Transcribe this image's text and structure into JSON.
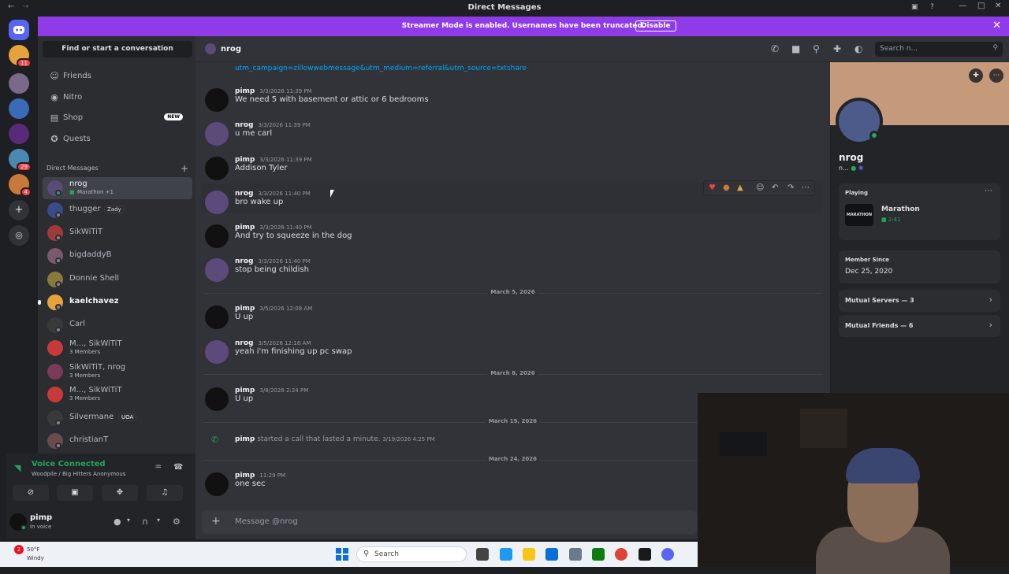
{
  "titlebar": {
    "title": "Direct Messages"
  },
  "banner": {
    "text": "Streamer Mode is enabled. Usernames have been truncated.",
    "button": "Disable"
  },
  "servers": [
    {
      "badge": ""
    },
    {
      "badge": "11"
    },
    {
      "badge": ""
    },
    {
      "badge": ""
    },
    {
      "badge": ""
    },
    {
      "badge": "29"
    },
    {
      "badge": "4"
    }
  ],
  "sidebar": {
    "find": "Find or start a conversation",
    "nav": [
      {
        "label": "Friends",
        "icon": "friends-icon"
      },
      {
        "label": "Nitro",
        "icon": "nitro-icon"
      },
      {
        "label": "Shop",
        "icon": "shop-icon",
        "tag": "NEW"
      },
      {
        "label": "Quests",
        "icon": "quests-icon"
      }
    ],
    "dm_header": "Direct Messages",
    "dms": [
      {
        "name": "nrog",
        "sub": "Marathon +1",
        "online": true
      },
      {
        "name": "thugger",
        "tag": "Zady",
        "online": false
      },
      {
        "name": "SikWiTiT",
        "online": false
      },
      {
        "name": "bigdaddyB",
        "online": false
      },
      {
        "name": "Donnie Shell",
        "online": false
      },
      {
        "name": "kaelchavez",
        "online": false
      },
      {
        "name": "Carl",
        "online": false
      },
      {
        "name": "M..., SikWiTiT",
        "sub": "3 Members"
      },
      {
        "name": "SikWiTiT, nrog",
        "sub": "3 Members"
      },
      {
        "name": "M..., SikWiTiT",
        "sub": "3 Members"
      },
      {
        "name": "Silvermane",
        "tag": "UOA",
        "online": false
      },
      {
        "name": "christianT",
        "online": false
      }
    ]
  },
  "voice": {
    "status": "Voice Connected",
    "channel": "Woodpile / Big Hitters Anonymous"
  },
  "user": {
    "name": "pimp",
    "status": "In voice"
  },
  "chat": {
    "recipient": "nrog",
    "search_placeholder": "Search n...",
    "link": "utm_campaign=zillowwebmessage&utm_medium=referral&utm_source=txtshare",
    "messages": [
      {
        "author": "pimp",
        "time": "3/3/2026 11:39 PM",
        "text": "We need 5 with basement or attic or 6 bedrooms"
      },
      {
        "author": "nrog",
        "time": "3/3/2026 11:39 PM",
        "text": "u me carl"
      },
      {
        "author": "pimp",
        "time": "3/3/2026 11:39 PM",
        "text": "Addison Tyler"
      },
      {
        "author": "nrog",
        "time": "3/3/2026 11:40 PM",
        "text": "bro wake up"
      },
      {
        "author": "pimp",
        "time": "3/3/2026 11:40 PM",
        "text": "And try to squeeze in the dog"
      },
      {
        "author": "nrog",
        "time": "3/3/2026 11:40 PM",
        "text": "stop being childish"
      },
      {
        "author": "pimp",
        "time": "3/5/2026 12:08 AM",
        "text": "U up"
      },
      {
        "author": "nrog",
        "time": "3/5/2026 12:16 AM",
        "text": "yeah i'm finishing up pc swap"
      },
      {
        "author": "pimp",
        "time": "3/8/2026 2:24 PM",
        "text": "U up"
      },
      {
        "author": "pimp",
        "time": "11:29 PM",
        "text": "one sec"
      }
    ],
    "dates": [
      "March 5, 2026",
      "March 8, 2026",
      "March 19, 2026",
      "March 24, 2026"
    ],
    "call": {
      "author": "pimp",
      "text": "started a call that lasted a minute.",
      "time": "3/19/2026 4:25 PM"
    },
    "composer_placeholder": "Message @nrog"
  },
  "profile": {
    "name": "nrog",
    "sub": "n...",
    "activity_label": "Playing",
    "game": "Marathon",
    "game_logo": "MARATHON",
    "game_time": "2:41",
    "member_since_label": "Member Since",
    "member_since": "Dec 25, 2020",
    "mutual_servers": "Mutual Servers — 3",
    "mutual_friends": "Mutual Friends — 6"
  },
  "taskbar": {
    "temp": "50°F",
    "weather": "Windy",
    "search": "Search",
    "notif": "2"
  },
  "colors": {
    "accent": "#5865f2",
    "banner": "#8f3ce8",
    "online": "#23a55a",
    "link": "#00a8fc"
  }
}
